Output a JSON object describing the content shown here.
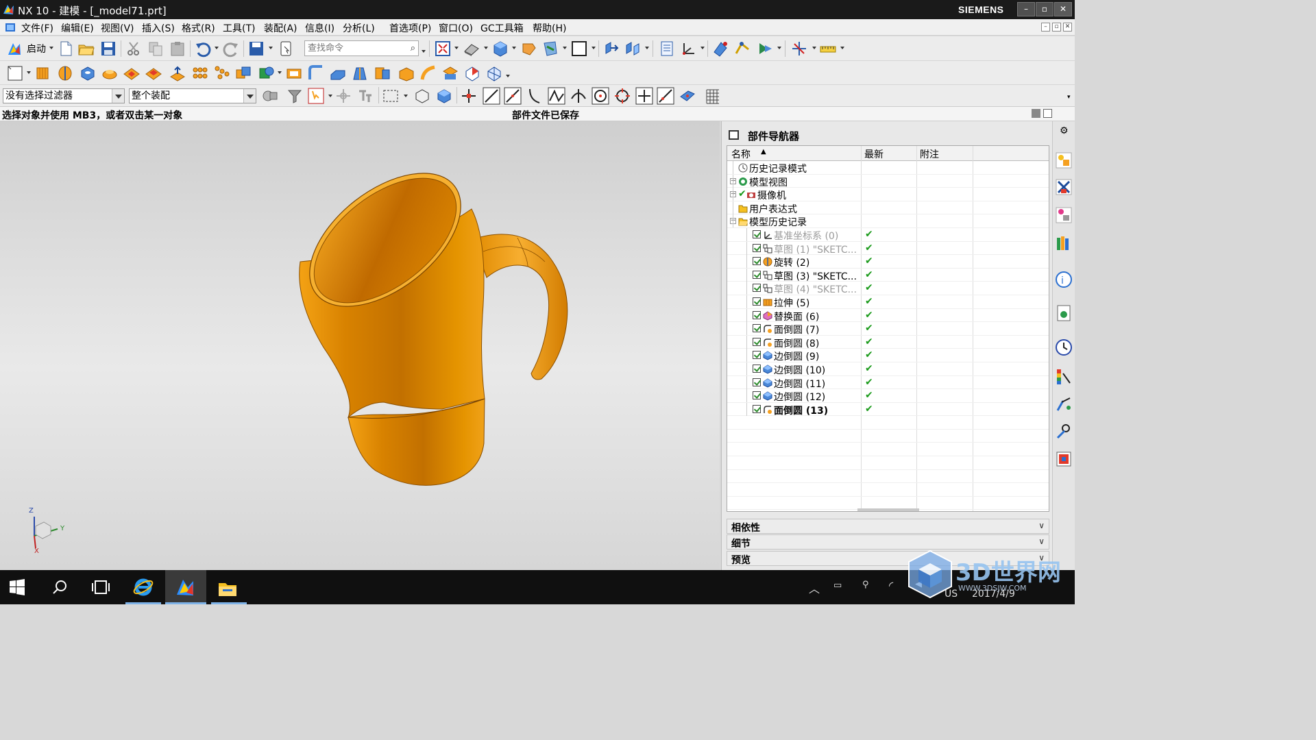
{
  "window": {
    "title": "NX 10 - 建模 - [_model71.prt]",
    "brand": "SIEMENS",
    "controls": {
      "minimize": "–",
      "restore": "▫",
      "close": "✕"
    }
  },
  "menu": {
    "items": [
      "文件(F)",
      "编辑(E)",
      "视图(V)",
      "插入(S)",
      "格式(R)",
      "工具(T)",
      "装配(A)",
      "信息(I)",
      "分析(L)",
      "首选项(P)",
      "窗口(O)",
      "GC工具箱",
      "帮助(H)"
    ]
  },
  "toolbar": {
    "start_label": "启动",
    "search_placeholder": "查找命令",
    "selection_filter": "没有选择过滤器",
    "assembly_scope": "整个装配"
  },
  "status": {
    "prompt": "选择对象并使用 MB3，或者双击某一对象",
    "message": "部件文件已保存"
  },
  "navigator": {
    "title": "部件导航器",
    "columns": {
      "name": "名称",
      "latest": "最新",
      "notes": "附注"
    },
    "rows": [
      {
        "label": "历史记录模式",
        "level": 0,
        "icon": "clock-icon",
        "expand": "",
        "dim": false,
        "bold": false,
        "latest": ""
      },
      {
        "label": "模型视图",
        "level": 0,
        "icon": "model-views-icon",
        "expand": "+",
        "dim": false,
        "bold": false,
        "latest": ""
      },
      {
        "label": "摄像机",
        "level": 0,
        "icon": "camera-icon",
        "expand": "+",
        "dim": false,
        "bold": false,
        "latest": ""
      },
      {
        "label": "用户表达式",
        "level": 0,
        "icon": "folder-icon",
        "expand": "",
        "dim": false,
        "bold": false,
        "latest": ""
      },
      {
        "label": "模型历史记录",
        "level": 0,
        "icon": "folder-open-icon",
        "expand": "−",
        "dim": false,
        "bold": false,
        "latest": ""
      },
      {
        "label": "基准坐标系 (0)",
        "level": 1,
        "icon": "datum-csys-icon",
        "expand": "",
        "dim": true,
        "bold": false,
        "latest": "✔"
      },
      {
        "label": "草图 (1) \"SKETC...",
        "level": 1,
        "icon": "sketch-icon",
        "expand": "",
        "dim": true,
        "bold": false,
        "latest": "✔"
      },
      {
        "label": "旋转 (2)",
        "level": 1,
        "icon": "revolve-icon",
        "expand": "",
        "dim": false,
        "bold": false,
        "latest": "✔"
      },
      {
        "label": "草图 (3) \"SKETC...",
        "level": 1,
        "icon": "sketch-icon",
        "expand": "",
        "dim": false,
        "bold": false,
        "latest": "✔"
      },
      {
        "label": "草图 (4) \"SKETC...",
        "level": 1,
        "icon": "sketch-icon",
        "expand": "",
        "dim": true,
        "bold": false,
        "latest": "✔"
      },
      {
        "label": "拉伸 (5)",
        "level": 1,
        "icon": "extrude-icon",
        "expand": "",
        "dim": false,
        "bold": false,
        "latest": "✔"
      },
      {
        "label": "替换面 (6)",
        "level": 1,
        "icon": "replace-face-icon",
        "expand": "",
        "dim": false,
        "bold": false,
        "latest": "✔"
      },
      {
        "label": "面倒圆 (7)",
        "level": 1,
        "icon": "face-blend-icon",
        "expand": "",
        "dim": false,
        "bold": false,
        "latest": "✔"
      },
      {
        "label": "面倒圆 (8)",
        "level": 1,
        "icon": "face-blend-icon",
        "expand": "",
        "dim": false,
        "bold": false,
        "latest": "✔"
      },
      {
        "label": "边倒圆 (9)",
        "level": 1,
        "icon": "edge-blend-icon",
        "expand": "",
        "dim": false,
        "bold": false,
        "latest": "✔"
      },
      {
        "label": "边倒圆 (10)",
        "level": 1,
        "icon": "edge-blend-icon",
        "expand": "",
        "dim": false,
        "bold": false,
        "latest": "✔"
      },
      {
        "label": "边倒圆 (11)",
        "level": 1,
        "icon": "edge-blend-icon",
        "expand": "",
        "dim": false,
        "bold": false,
        "latest": "✔"
      },
      {
        "label": "边倒圆 (12)",
        "level": 1,
        "icon": "edge-blend-icon",
        "expand": "",
        "dim": false,
        "bold": false,
        "latest": "✔"
      },
      {
        "label": "面倒圆 (13)",
        "level": 1,
        "icon": "face-blend-icon",
        "expand": "",
        "dim": false,
        "bold": true,
        "latest": "✔"
      }
    ],
    "panels": [
      "相依性",
      "细节",
      "预览"
    ]
  },
  "triad": {
    "z": "Z",
    "y": "Y",
    "x": "X"
  },
  "taskbar": {
    "lang": "US",
    "date": "2017/4/9"
  },
  "watermark": {
    "text": "3D世界网",
    "url": "WWW.3DSJW.COM"
  },
  "colors": {
    "part": "#e38a00",
    "part_light": "#f4a21a",
    "part_dark": "#b86a00",
    "check_green": "#1a9a1a",
    "taskbar": "#101010"
  }
}
